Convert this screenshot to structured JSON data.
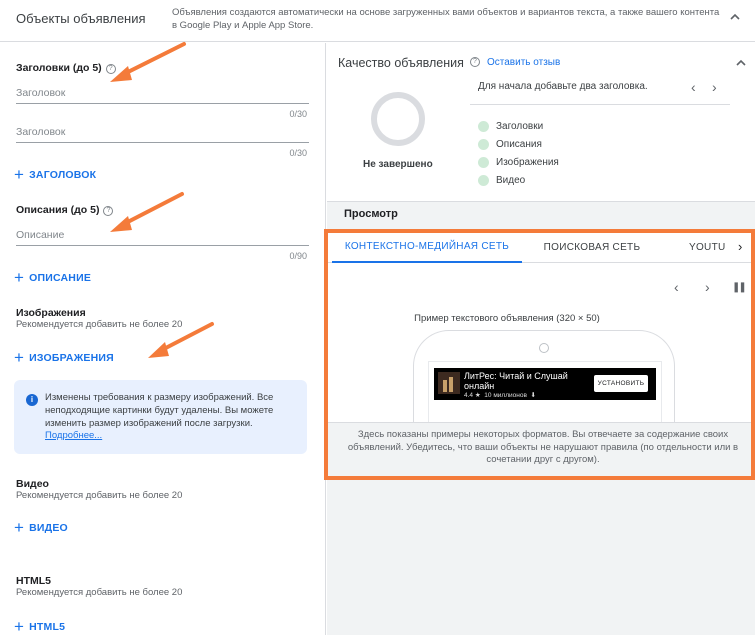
{
  "header": {
    "title": "Объекты объявления",
    "description": "Объявления создаются автоматически на основе загруженных вами объектов и вариантов текста, а также вашего контента в Google Play и Apple App Store."
  },
  "headlines": {
    "label": "Заголовки (до 5)",
    "fields": [
      {
        "placeholder": "Заголовок",
        "counter": "0/30"
      },
      {
        "placeholder": "Заголовок",
        "counter": "0/30"
      }
    ],
    "add_label": "ЗАГОЛОВОК"
  },
  "descriptions": {
    "label": "Описания (до 5)",
    "fields": [
      {
        "placeholder": "Описание",
        "counter": "0/90"
      }
    ],
    "add_label": "ОПИСАНИЕ"
  },
  "images": {
    "label": "Изображения",
    "hint": "Рекомендуется добавить не более 20",
    "add_label": "ИЗОБРАЖЕНИЯ",
    "notice": "Изменены требования к размеру изображений. Все неподходящие картинки будут удалены. Вы можете изменить размер изображений после загрузки.",
    "notice_link": "Подробнее..."
  },
  "video": {
    "label": "Видео",
    "hint": "Рекомендуется добавить не более 20",
    "add_label": "ВИДЕО"
  },
  "html5": {
    "label": "HTML5",
    "hint": "Рекомендуется добавить не более 20",
    "add_label": "HTML5"
  },
  "quality": {
    "title": "Качество объявления",
    "feedback": "Оставить отзыв",
    "status": "Не завершено",
    "message": "Для начала добавьте два заголовка.",
    "checklist": [
      "Заголовки",
      "Описания",
      "Изображения",
      "Видео"
    ]
  },
  "preview": {
    "label": "Просмотр",
    "tabs": [
      "КОНТЕКСТНО-МЕДИЙНАЯ СЕТЬ",
      "ПОИСКОВАЯ СЕТЬ",
      "YOUTU"
    ],
    "sample_label": "Пример текстового объявления (320 × 50)",
    "ad": {
      "title": "ЛитРес: Читай и Слушай онлайн",
      "rating": "4.4 ★",
      "downloads": "10 миллионов",
      "install": "УСТАНОВИТЬ"
    },
    "disclaimer": "Здесь показаны примеры некоторых форматов. Вы отвечаете за содержание своих объявлений. Убедитесь, что ваши объекты не нарушают правила (по отдельности или в сочетании друг с другом)."
  },
  "icons": {
    "help": "?",
    "info": "i",
    "plus": "+",
    "prev": "‹",
    "next": "›",
    "pause": "❚❚",
    "download": "⬇",
    "tab_next": "›"
  },
  "colors": {
    "accent": "#1a73e8",
    "annotation": "#f47b3a",
    "check": "#ceead6",
    "notice_bg": "#e8f0fe"
  }
}
